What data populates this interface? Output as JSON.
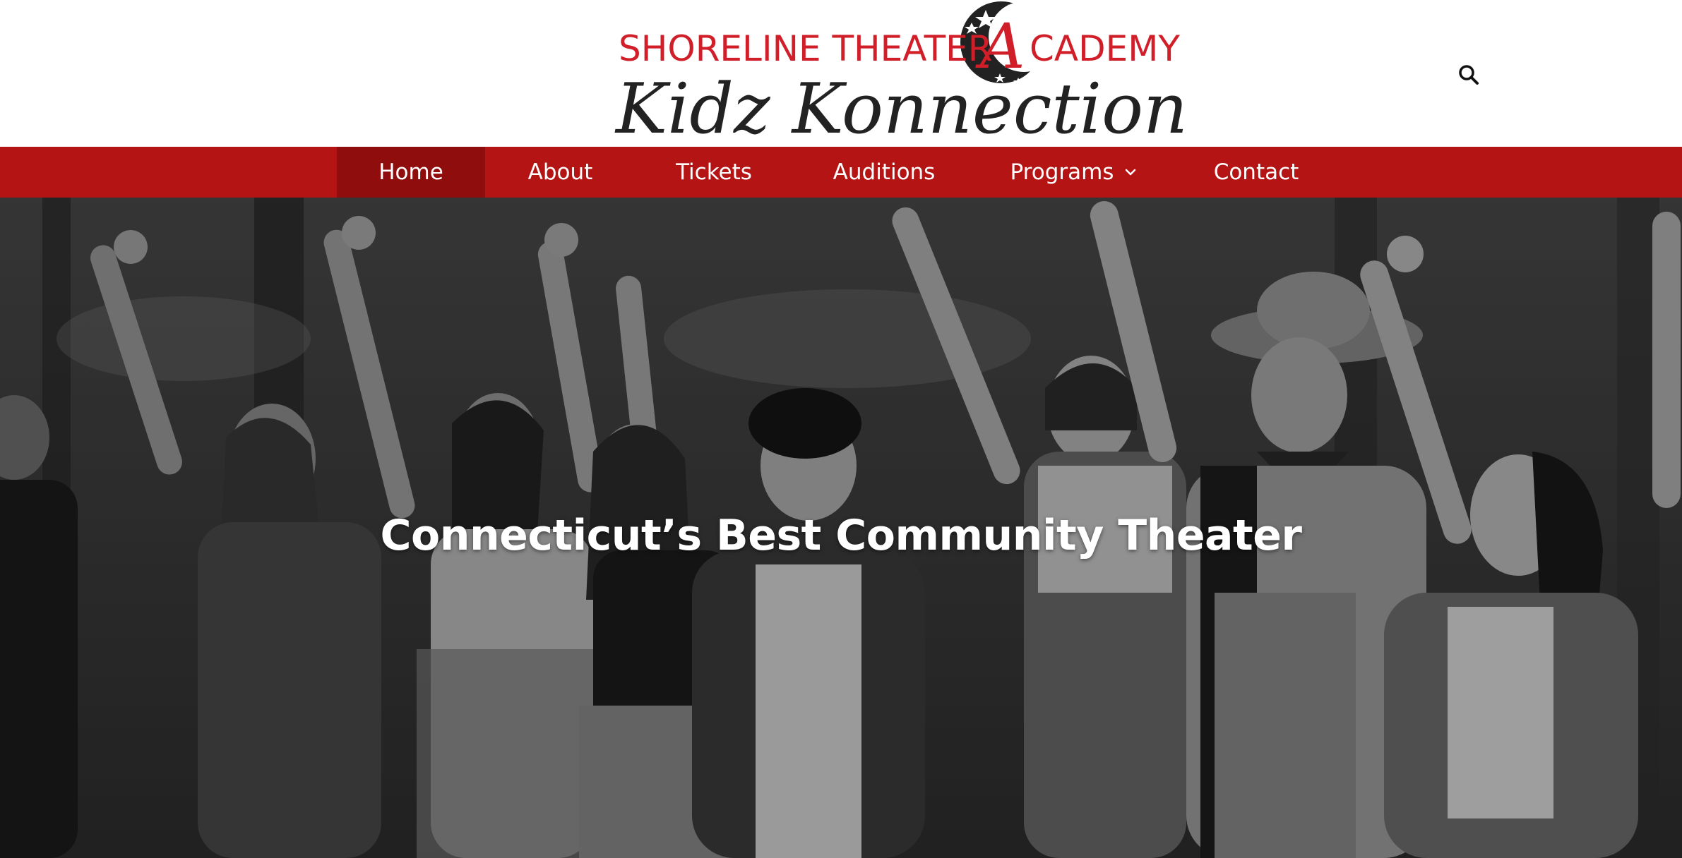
{
  "header": {
    "logo": {
      "line1_left": "SHORELINE THEATER",
      "line1_letter": "A",
      "line1_right": "CADEMY",
      "line2": "Kidz Konnection"
    },
    "search_icon": "search-icon"
  },
  "nav": {
    "items": [
      {
        "label": "Home",
        "active": true
      },
      {
        "label": "About",
        "active": false
      },
      {
        "label": "Tickets",
        "active": false
      },
      {
        "label": "Auditions",
        "active": false
      },
      {
        "label": "Programs",
        "active": false,
        "has_dropdown": true
      },
      {
        "label": "Contact",
        "active": false
      }
    ]
  },
  "hero": {
    "title": "Connecticut’s Best Community Theater",
    "image_description_icon": "group-photo"
  },
  "colors": {
    "brand_red": "#b51415",
    "active_red": "#8f0d0d",
    "logo_red": "#d11f2a",
    "logo_dark": "#222222"
  }
}
